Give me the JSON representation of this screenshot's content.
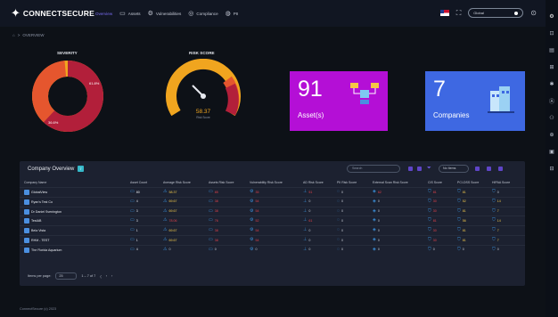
{
  "brand": {
    "logo_glyph": "✦",
    "name": "CONNECTSECURE"
  },
  "nav": [
    {
      "icon": "",
      "label": "Overview",
      "active": true
    },
    {
      "icon": "▭",
      "label": "Assets"
    },
    {
      "icon": "⚙",
      "label": "Vulnerabilities"
    },
    {
      "icon": "◎",
      "label": "Compliance"
    },
    {
      "icon": "◍",
      "label": "PII"
    }
  ],
  "topbar": {
    "expand_icon": "⛶",
    "select_value": "Global",
    "help_icon": "⊙"
  },
  "breadcrumb": {
    "home_icon": "⌂",
    "sep": ">",
    "page": "OVERVIEW"
  },
  "severity": {
    "title": "SEVERITY",
    "high_pct": "36.6%",
    "critical_pct": "61.8%"
  },
  "risk": {
    "title": "RISK SCORE",
    "score": "58.37",
    "label": "Risk Score",
    "score_fraction": 0.58
  },
  "assets": {
    "count": "91",
    "label": "Asset(s)"
  },
  "companies": {
    "count": "7",
    "label": "Companies"
  },
  "overview": {
    "title": "Company Overview",
    "badge": "7",
    "search_placeholder": "Search",
    "filter_icon": "⏷",
    "select": "No Items",
    "columns": [
      "Company Name",
      "Asset Count",
      "Average Risk Score",
      "Assets Risk Score",
      "Vulnerability Risk Score",
      "AD Risk Score",
      "PII Risk Score",
      "External Scan Risk Score",
      "CIS Score",
      "PCI-DSS Score",
      "HIPAA Score"
    ],
    "rows": [
      {
        "name": "GlobalView",
        "asset": "80",
        "avg": "58.37",
        "assets": "85",
        "vuln": "35",
        "ad": "51",
        "pii": "0",
        "ext": "62",
        "cis": "81",
        "pci": "81",
        "hipaa": "0"
      },
      {
        "name": "Ryan's Test Co",
        "asset": "4",
        "avg": "69.67",
        "assets": "38",
        "vuln": "54",
        "ad": "0",
        "pii": "0",
        "ext": "0",
        "cis": "30",
        "pci": "52",
        "hipaa": "14"
      },
      {
        "name": "Dr Daniel Svenington",
        "asset": "3",
        "avg": "69.67",
        "assets": "38",
        "vuln": "54",
        "ad": "0",
        "pii": "0",
        "ext": "0",
        "cis": "30",
        "pci": "81",
        "hipaa": "7"
      },
      {
        "name": "TestAB",
        "asset": "3",
        "avg": "78.06",
        "assets": "76",
        "vuln": "52",
        "ad": "61",
        "pii": "0",
        "ext": "0",
        "cis": "81",
        "pci": "56",
        "hipaa": "14"
      },
      {
        "name": "Bela Vista",
        "asset": "1",
        "avg": "69.67",
        "assets": "38",
        "vuln": "54",
        "ad": "0",
        "pii": "0",
        "ext": "0",
        "cis": "30",
        "pci": "81",
        "hipaa": "7"
      },
      {
        "name": "RHM - TEST",
        "asset": "1",
        "avg": "69.67",
        "assets": "38",
        "vuln": "54",
        "ad": "0",
        "pii": "0",
        "ext": "0",
        "cis": "30",
        "pci": "81",
        "hipaa": "7"
      },
      {
        "name": "The Florida Aquarium",
        "asset": "4",
        "avg": "0",
        "assets": "0",
        "vuln": "0",
        "ad": "0",
        "pii": "0",
        "ext": "0",
        "cis": "0",
        "pci": "0",
        "hipaa": "0"
      }
    ],
    "items_per_page_label": "Items per page:",
    "items_per_page": "25",
    "range": "1 – 7 of 7"
  },
  "footer": "ConnectSecure (c) 2023",
  "sidebar_right": [
    "⚙",
    "⊡",
    "▤",
    "⊞",
    "✱",
    "Ⓐ",
    "⚇",
    "⊕",
    "▣",
    "⊟"
  ],
  "colors": {
    "bg": "#0d1117",
    "asset_card": "#b40fd6",
    "companies_card": "#3e68e2",
    "accent": "#6e59e3",
    "critical": "#b21f3a",
    "high": "#e5562e",
    "medium": "#f0a51f"
  }
}
